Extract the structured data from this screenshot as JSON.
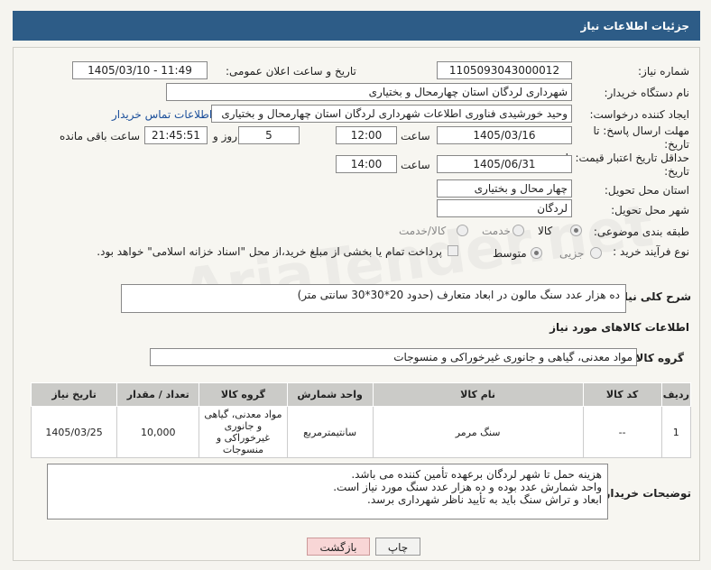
{
  "header": {
    "title": "جزئیات اطلاعات نیاز"
  },
  "form": {
    "need_number_label": "شماره نیاز:",
    "need_number": "1105093043000012",
    "announce_label": "تاریخ و ساعت اعلان عمومی:",
    "announce_value": "1405/03/10 - 11:49",
    "buyer_org_label": "نام دستگاه خریدار:",
    "buyer_org": "شهرداری لردگان استان چهارمحال و بختیاری",
    "creator_label": "ایجاد کننده درخواست:",
    "creator": "وحید خورشیدی فناوری اطلاعات شهرداری لردگان استان چهارمحال و بختیاری",
    "contact_link": "اطلاعات تماس خریدار",
    "deadline_label": "مهلت ارسال پاسخ: تا تاریخ:",
    "deadline_date": "1405/03/16",
    "time_label": "ساعت",
    "deadline_time": "12:00",
    "days_value": "5",
    "days_label": "روز و",
    "remaining_time": "21:45:51",
    "remaining_label": "ساعت باقی مانده",
    "validity_label": "حداقل تاریخ اعتبار قیمت: تا تاریخ:",
    "validity_date": "1405/06/31",
    "validity_time": "14:00",
    "province_label": "استان محل تحویل:",
    "province": "چهار محال و بختیاری",
    "city_label": "شهر محل تحویل:",
    "city": "لردگان",
    "category_label": "طبقه بندی موضوعی:",
    "category_options": [
      "کالا",
      "خدمت",
      "کالا/خدمت"
    ],
    "process_label": "نوع فرآیند خرید :",
    "process_options": [
      "جزیی",
      "متوسط"
    ],
    "payment_note": "پرداخت تمام یا بخشی از مبلغ خرید،از محل \"اسناد خزانه اسلامی\" خواهد بود.",
    "description_label": "شرح کلی نیاز:",
    "description": "ده هزار عدد سنگ مالون در ابعاد متعارف (حدود 20*30*30 سانتی متر)",
    "goods_info_title": "اطلاعات کالاهای مورد نیاز",
    "goods_group_label": "گروه کالا:",
    "goods_group": "مواد معدنی، گیاهی و جانوری غیرخوراکی و منسوجات"
  },
  "table": {
    "headers": [
      "ردیف",
      "کد کالا",
      "نام کالا",
      "واحد شمارش",
      "گروه کالا",
      "تعداد / مقدار",
      "تاریخ نیاز"
    ],
    "rows": [
      {
        "row": "1",
        "code": "--",
        "name": "سنگ مرمر",
        "unit": "سانتیمترمربع",
        "group": "مواد معدنی، گیاهی و جانوری غیرخوراکی و منسوجات",
        "qty": "10,000",
        "date": "1405/03/25"
      }
    ]
  },
  "notes": {
    "label": "توضیحات خریدار:",
    "lines": [
      "هزینه حمل تا شهر لردگان برعهده تأمین کننده می باشد.",
      "واحد شمارش عدد بوده و ده هزار عدد سنگ مورد نیاز است.",
      "ابعاد و تراش سنگ باید به تأیید ناظر شهرداری برسد."
    ]
  },
  "buttons": {
    "print": "چاپ",
    "back": "بازگشت"
  },
  "watermark": "AriaTender.net"
}
